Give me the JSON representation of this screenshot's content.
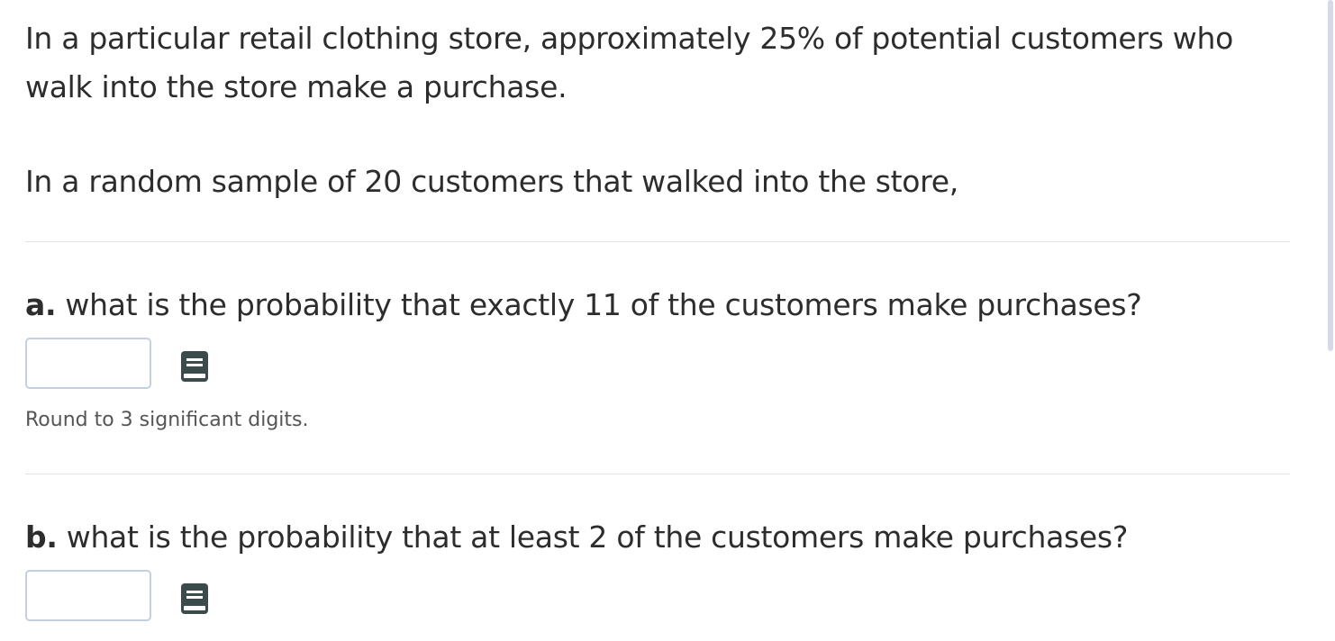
{
  "problem": {
    "intro": "In a particular retail clothing store, approximately 25% of potential customers who walk into the store make a purchase.",
    "sample": "In a random sample of 20 customers that walked into the store,"
  },
  "questions": [
    {
      "letter": "a.",
      "text": " what is the probability that exactly 11 of the customers make purchases?",
      "value": "",
      "hint": "Round to 3 significant digits."
    },
    {
      "letter": "b.",
      "text": " what is the probability that at least 2 of the customers make purchases?",
      "value": ""
    }
  ],
  "icons": {
    "question_help": "book-icon"
  },
  "colors": {
    "text": "#2d2d2d",
    "input_border": "#c3cfe3",
    "icon": "#3b4a4a",
    "divider": "#e3e3e3"
  }
}
